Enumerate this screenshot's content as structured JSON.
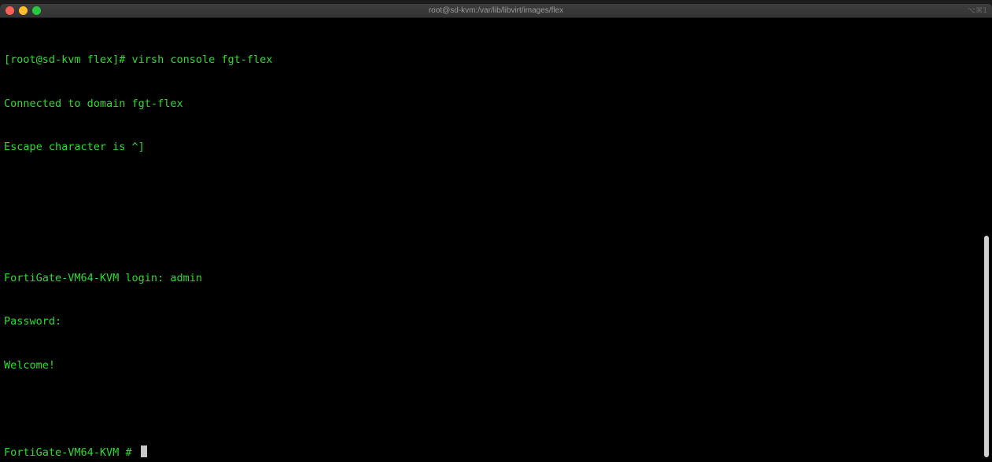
{
  "window": {
    "title": "root@sd-kvm:/var/lib/libvirt/images/flex",
    "shortcut": "⌥⌘1"
  },
  "terminal": {
    "lines": [
      "[root@sd-kvm flex]# virsh console fgt-flex",
      "Connected to domain fgt-flex",
      "Escape character is ^]",
      "",
      "",
      "FortiGate-VM64-KVM login: admin",
      "Password:",
      "Welcome!",
      "",
      "FortiGate-VM64-KVM # "
    ]
  },
  "colors": {
    "terminal_text": "#2fdc2f",
    "terminal_background": "#000000",
    "close": "#fe5f57",
    "minimize": "#febc2e",
    "zoom": "#28c840"
  }
}
